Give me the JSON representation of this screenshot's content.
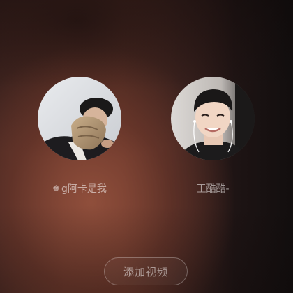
{
  "participants": [
    {
      "name": "g阿卡是我",
      "badge_icon": "crown-icon",
      "badge_glyph": "♚"
    },
    {
      "name": "王酷酷-"
    }
  ],
  "actions": {
    "add_video_label": "添加视频"
  },
  "colors": {
    "background_warm": "#6b3b2e",
    "background_dark": "#120e0e",
    "text_muted": "rgba(255,255,255,0.55)"
  }
}
